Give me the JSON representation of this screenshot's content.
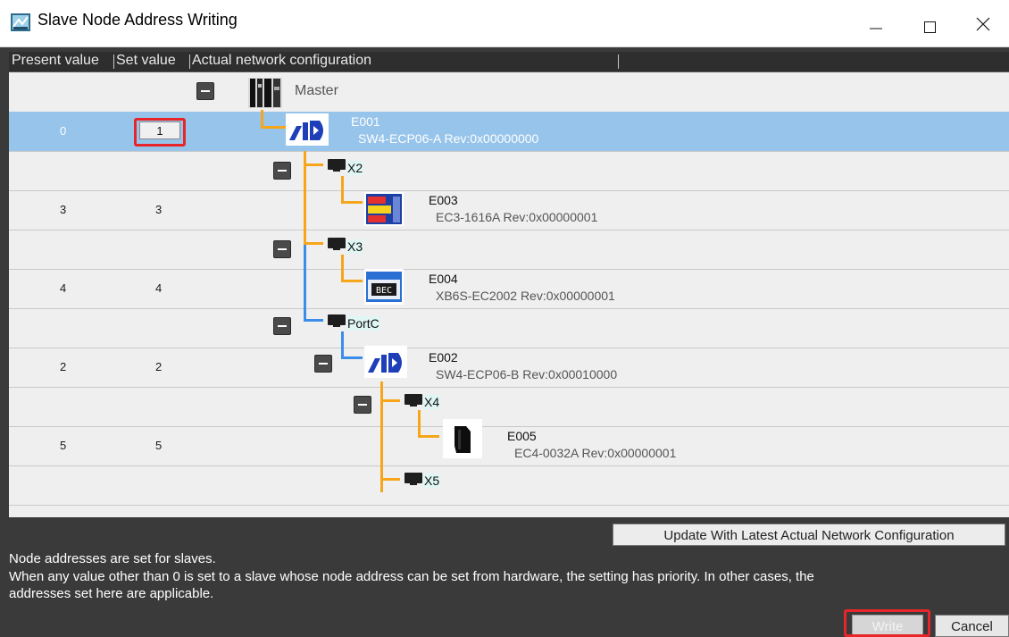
{
  "window": {
    "title": "Slave Node Address Writing",
    "icon": "network-window-icon"
  },
  "columns": [
    "Present value",
    "Set value",
    "Actual network configuration"
  ],
  "tree": {
    "master": {
      "label": "Master"
    },
    "rows": [
      {
        "present": "0",
        "set": "1",
        "name": "E001",
        "model": "SW4-ECP06-A Rev:0x00000000",
        "selected": true
      },
      {
        "port": "X2"
      },
      {
        "present": "3",
        "set": "3",
        "name": "E003",
        "model": "EC3-1616A Rev:0x00000001"
      },
      {
        "port": "X3"
      },
      {
        "present": "4",
        "set": "4",
        "name": "E004",
        "model": "XB6S-EC2002 Rev:0x00000001"
      },
      {
        "port": "PortC"
      },
      {
        "present": "2",
        "set": "2",
        "name": "E002",
        "model": "SW4-ECP06-B Rev:0x00010000"
      },
      {
        "port": "X4"
      },
      {
        "present": "5",
        "set": "5",
        "name": "E005",
        "model": "EC4-0032A Rev:0x00000001"
      },
      {
        "port": "X5"
      }
    ]
  },
  "buttons": {
    "update": "Update With Latest Actual Network Configuration",
    "write": "Write",
    "cancel": "Cancel"
  },
  "message": {
    "line1": "Node addresses are set for slaves.",
    "line2": "When any value other than 0 is set to a slave whose node address can be set from hardware, the setting has priority. In other cases, the",
    "line3": "addresses set here are applicable."
  },
  "colors": {
    "selection": "#97c4ea",
    "highlight": "#e8262a",
    "line_orange": "#f7a51a",
    "line_blue": "#3b8ee8"
  }
}
